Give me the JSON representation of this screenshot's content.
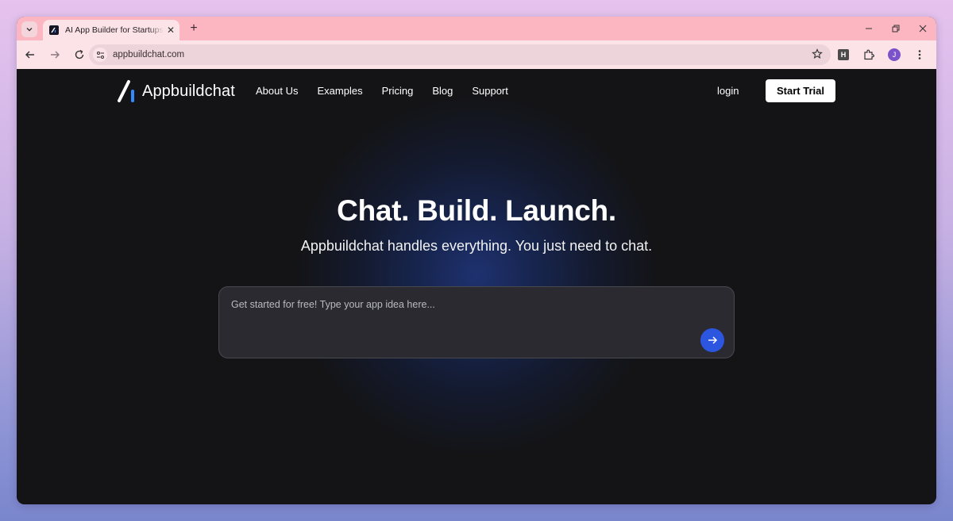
{
  "browser": {
    "tab_title": "AI App Builder for Startups – Bu",
    "new_tab_symbol": "+",
    "tab_close_symbol": "✕",
    "url": "appbuildchat.com",
    "profile_initial": "J",
    "extension_label": "H"
  },
  "site": {
    "brand": "Appbuildchat",
    "nav": [
      "About Us",
      "Examples",
      "Pricing",
      "Blog",
      "Support"
    ],
    "login_label": "login",
    "cta_label": "Start Trial"
  },
  "hero": {
    "title": "Chat. Build. Launch.",
    "subtitle": "Appbuildchat handles everything. You just need to chat.",
    "placeholder": "Get started for free! Type your app idea here..."
  },
  "colors": {
    "tabstrip": "#fbb6c2",
    "toolbar": "#fbe3e8",
    "page_bg": "#141416",
    "accent": "#2c55e0"
  }
}
